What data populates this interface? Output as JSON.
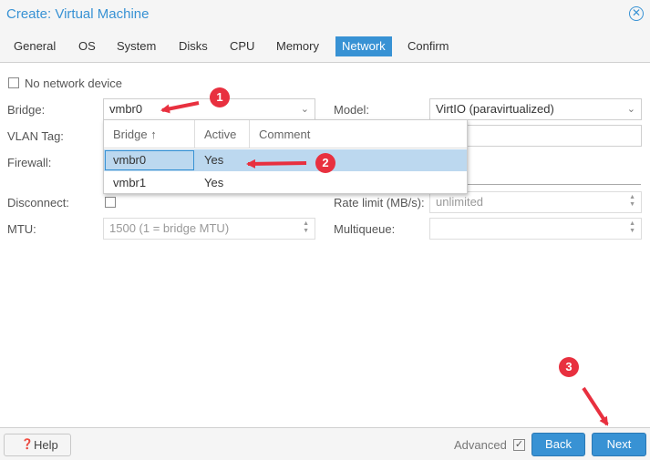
{
  "window": {
    "title": "Create: Virtual Machine",
    "close_icon": "close-icon"
  },
  "tabs": [
    "General",
    "OS",
    "System",
    "Disks",
    "CPU",
    "Memory",
    "Network",
    "Confirm"
  ],
  "active_tab": "Network",
  "form": {
    "no_network_label": "No network device",
    "bridge_label": "Bridge:",
    "bridge_value": "vmbr0",
    "model_label": "Model:",
    "model_value": "VirtIO (paravirtualized)",
    "vlan_label": "VLAN Tag:",
    "firewall_label": "Firewall:",
    "disconnect_label": "Disconnect:",
    "rate_label": "Rate limit (MB/s):",
    "rate_placeholder": "unlimited",
    "mtu_label": "MTU:",
    "mtu_placeholder": "1500 (1 = bridge MTU)",
    "multiqueue_label": "Multiqueue:"
  },
  "bridge_dropdown": {
    "columns": [
      "Bridge ↑",
      "Active",
      "Comment"
    ],
    "rows": [
      {
        "bridge": "vmbr0",
        "active": "Yes",
        "comment": ""
      },
      {
        "bridge": "vmbr1",
        "active": "Yes",
        "comment": ""
      }
    ],
    "selected": "vmbr0"
  },
  "footer": {
    "help_label": "Help",
    "advanced_label": "Advanced",
    "advanced_checked": true,
    "back_label": "Back",
    "next_label": "Next"
  },
  "annotations": {
    "badges": [
      "1",
      "2",
      "3"
    ],
    "color": "#e8303f"
  },
  "colors": {
    "accent": "#3892d4",
    "selection": "#bcd8ef"
  }
}
